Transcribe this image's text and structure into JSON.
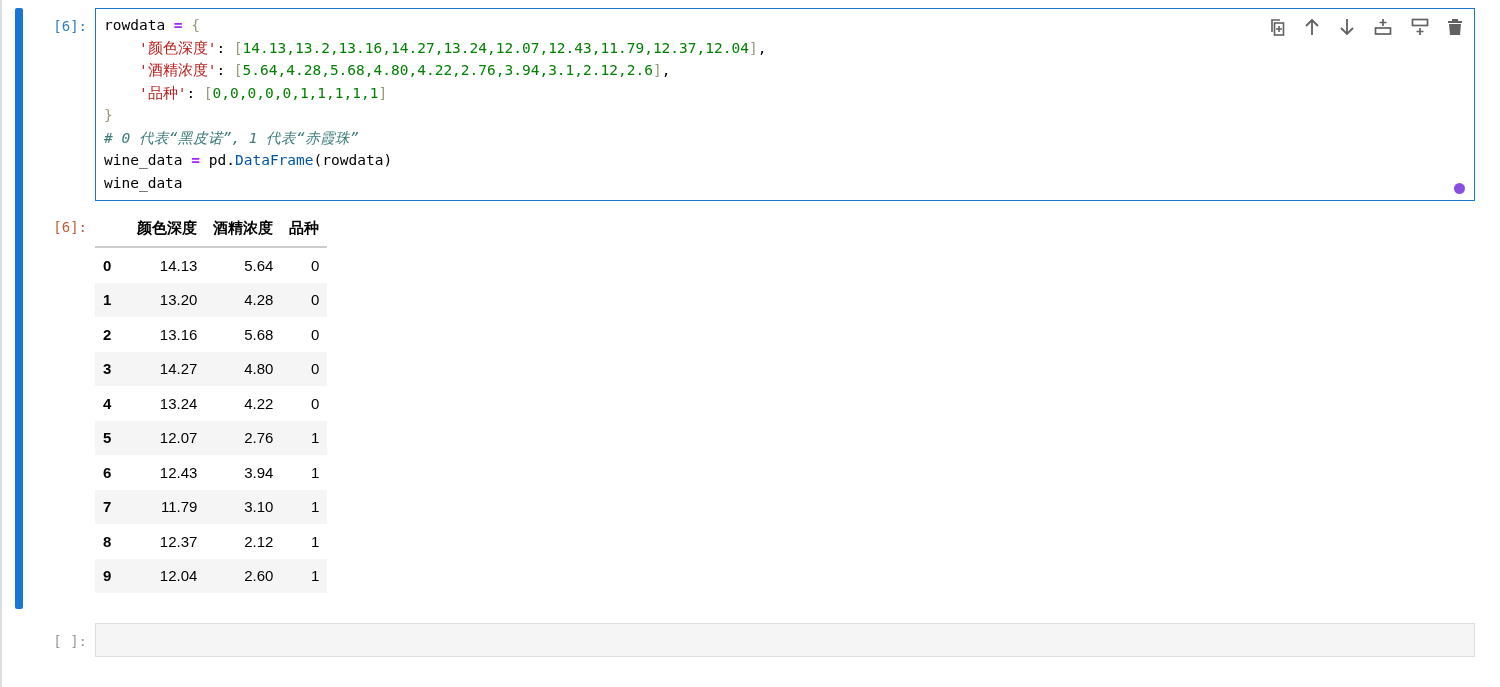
{
  "code_cell": {
    "prompt": "[6]:",
    "selected": true,
    "modified": true,
    "toolbar": [
      {
        "kind": "duplicate"
      },
      {
        "kind": "up"
      },
      {
        "kind": "down"
      },
      {
        "kind": "insert-above"
      },
      {
        "kind": "insert-below"
      },
      {
        "kind": "delete"
      }
    ],
    "lines": [
      [
        {
          "kind": "name",
          "text": "rowdata "
        },
        {
          "kind": "op",
          "text": "= "
        },
        {
          "kind": "bracket",
          "text": "{"
        }
      ],
      [
        {
          "kind": "str",
          "text": "    '颜色深度'"
        },
        {
          "kind": "name",
          "text": ": "
        },
        {
          "kind": "bracket",
          "text": "["
        },
        {
          "kind": "num",
          "text": "14.13,13.2,13.16,14.27,13.24,12.07,12.43,11.79,12.37,12.04"
        },
        {
          "kind": "bracket",
          "text": "]"
        },
        {
          "kind": "name",
          "text": ","
        }
      ],
      [
        {
          "kind": "str",
          "text": "    '酒精浓度'"
        },
        {
          "kind": "name",
          "text": ": "
        },
        {
          "kind": "bracket",
          "text": "["
        },
        {
          "kind": "num",
          "text": "5.64,4.28,5.68,4.80,4.22,2.76,3.94,3.1,2.12,2.6"
        },
        {
          "kind": "bracket",
          "text": "]"
        },
        {
          "kind": "name",
          "text": ","
        }
      ],
      [
        {
          "kind": "str",
          "text": "    '品种'"
        },
        {
          "kind": "name",
          "text": ": "
        },
        {
          "kind": "bracket",
          "text": "["
        },
        {
          "kind": "num",
          "text": "0,0,0,0,0,1,1,1,1,1"
        },
        {
          "kind": "bracket",
          "text": "]"
        }
      ],
      [
        {
          "kind": "bracket",
          "text": "}"
        }
      ],
      [
        {
          "kind": "comment",
          "text": "# 0 代表“黑皮诺”, 1 代表“赤霞珠”"
        }
      ],
      [
        {
          "kind": "name",
          "text": "wine_data "
        },
        {
          "kind": "op",
          "text": "="
        },
        {
          "kind": "name",
          "text": " pd."
        },
        {
          "kind": "attr",
          "text": "DataFrame"
        },
        {
          "kind": "name",
          "text": "(rowdata)"
        }
      ],
      [
        {
          "kind": "name",
          "text": "wine_data"
        }
      ]
    ]
  },
  "output": {
    "prompt": "[6]:",
    "columns": [
      "颜色深度",
      "酒精浓度",
      "品种"
    ],
    "rows": [
      {
        "index": "0",
        "cells": [
          "14.13",
          "5.64",
          "0"
        ]
      },
      {
        "index": "1",
        "cells": [
          "13.20",
          "4.28",
          "0"
        ]
      },
      {
        "index": "2",
        "cells": [
          "13.16",
          "5.68",
          "0"
        ]
      },
      {
        "index": "3",
        "cells": [
          "14.27",
          "4.80",
          "0"
        ]
      },
      {
        "index": "4",
        "cells": [
          "13.24",
          "4.22",
          "0"
        ]
      },
      {
        "index": "5",
        "cells": [
          "12.07",
          "2.76",
          "1"
        ]
      },
      {
        "index": "6",
        "cells": [
          "12.43",
          "3.94",
          "1"
        ]
      },
      {
        "index": "7",
        "cells": [
          "11.79",
          "3.10",
          "1"
        ]
      },
      {
        "index": "8",
        "cells": [
          "12.37",
          "2.12",
          "1"
        ]
      },
      {
        "index": "9",
        "cells": [
          "12.04",
          "2.60",
          "1"
        ]
      }
    ]
  },
  "empty_cell": {
    "prompt": "[ ]:"
  }
}
